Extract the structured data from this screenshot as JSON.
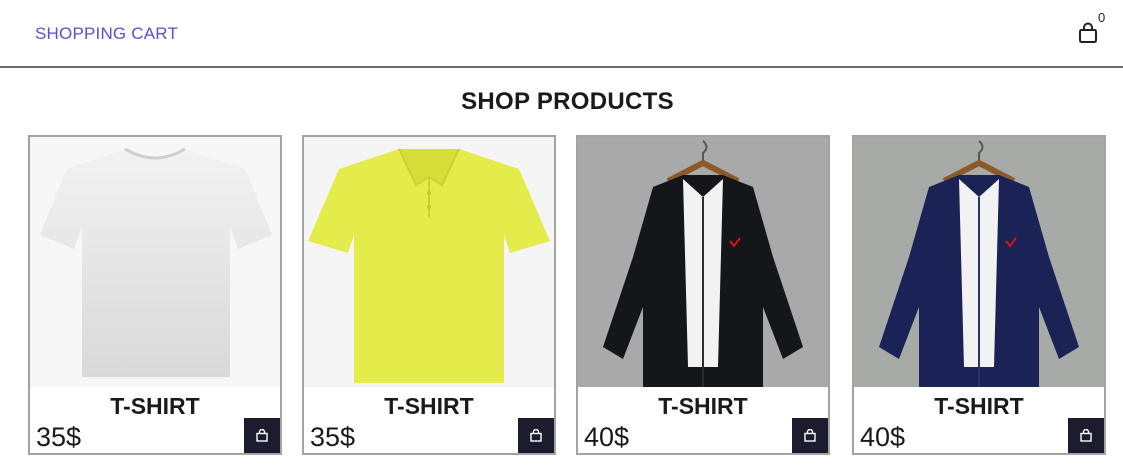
{
  "navbar": {
    "brand": "SHOPPING CART",
    "cart_icon": "shopping-bag-icon",
    "cart_count": "0"
  },
  "page_title": "SHOP PRODUCTS",
  "products": [
    {
      "name": "T-SHIRT",
      "price": "35$",
      "image": "white-tshirt",
      "add_icon": "shopping-bag-icon"
    },
    {
      "name": "T-SHIRT",
      "price": "35$",
      "image": "yellow-polo-shirt",
      "add_icon": "shopping-bag-icon"
    },
    {
      "name": "T-SHIRT",
      "price": "40$",
      "image": "black-shirt-on-hanger",
      "add_icon": "shopping-bag-icon"
    },
    {
      "name": "T-SHIRT",
      "price": "40$",
      "image": "navy-shirt-on-hanger",
      "add_icon": "shopping-bag-icon"
    }
  ],
  "colors": {
    "brand": "#5b4fd6",
    "button_bg": "#1c1c2e",
    "border": "#a3a3a3"
  }
}
